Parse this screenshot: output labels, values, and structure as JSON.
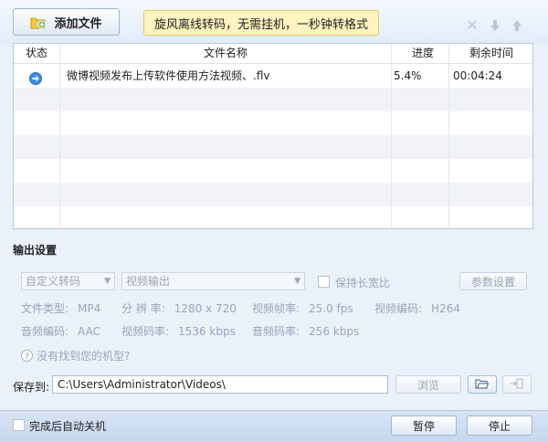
{
  "toolbar": {
    "add_file_label": "添加文件",
    "promo_text": "旋风离线转码，无需挂机，一秒钟转格式"
  },
  "table": {
    "headers": [
      "状态",
      "文件名称",
      "进度",
      "剩余时间"
    ],
    "rows": [
      {
        "status_icon": "arrow-right-icon",
        "filename": "微博视频发布上传软件使用方法视频、.flv",
        "progress": "5.4%",
        "remaining": "00:04:24"
      }
    ]
  },
  "output": {
    "title": "输出设置",
    "preset": "自定义转码",
    "format": "视频输出",
    "keep_ratio_label": "保持长宽比",
    "params_button": "参数设置",
    "file_type_label": "文件类型:",
    "file_type": "MP4",
    "resolution_label": "分 辨 率:",
    "resolution": "1280 x 720",
    "framerate_label": "视频帧率:",
    "framerate": "25.0 fps",
    "vcodec_label": "视频编码:",
    "vcodec": "H264",
    "acodec_label": "音频编码:",
    "acodec": "AAC",
    "vbitrate_label": "视频码率:",
    "vbitrate": "1536 kbps",
    "abitrate_label": "音频码率:",
    "abitrate": "256 kbps",
    "help_text": "没有找到您的机型?"
  },
  "save": {
    "label": "保存到:",
    "path": "C:\\Users\\Administrator\\Videos\\",
    "browse_label": "浏览"
  },
  "footer": {
    "auto_shutdown_label": "完成后自动关机",
    "pause_label": "暂停",
    "stop_label": "停止"
  }
}
